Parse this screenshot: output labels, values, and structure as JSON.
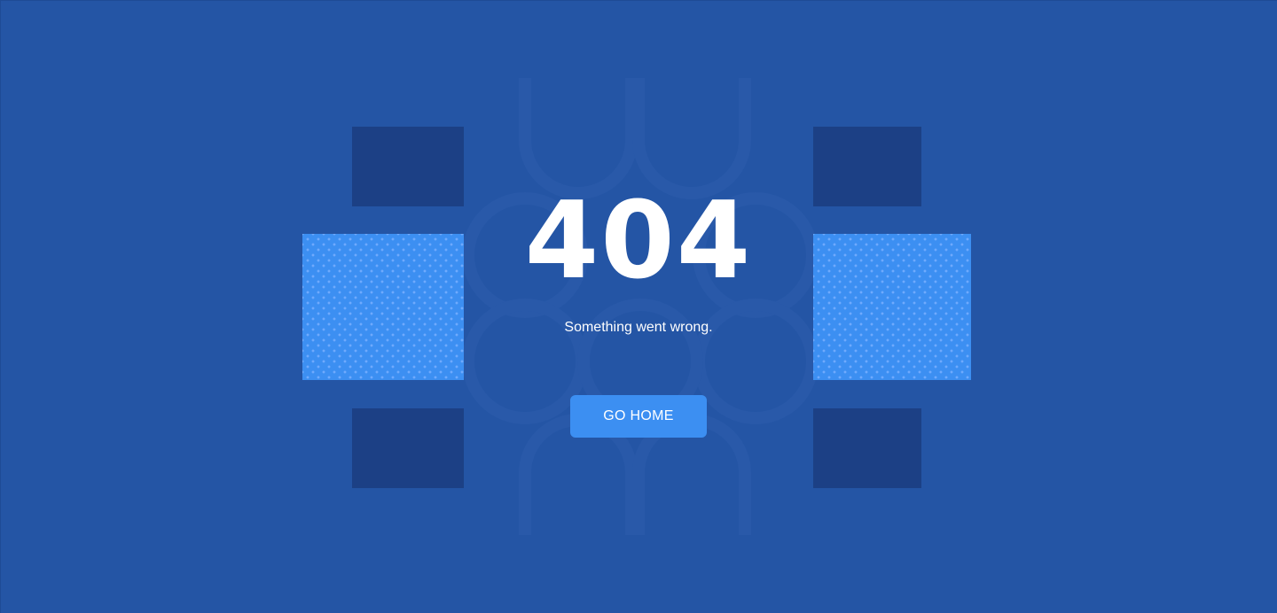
{
  "error": {
    "code": "404",
    "message": "Something went wrong.",
    "home_button_label": "GO HOME"
  },
  "colors": {
    "background": "#2455a5",
    "panel_dark": "#1c4085",
    "panel_light": "#3c8ff2",
    "button": "#3c8ff2",
    "text": "#ffffff"
  }
}
